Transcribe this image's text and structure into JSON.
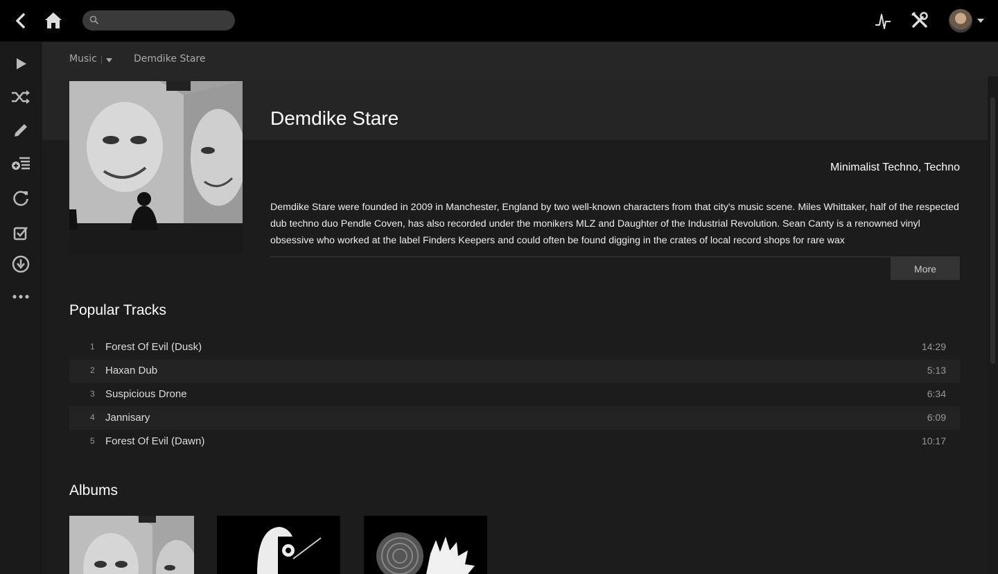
{
  "search": {
    "placeholder": ""
  },
  "breadcrumb": {
    "section": "Music",
    "current": "Demdike Stare"
  },
  "artist": {
    "name": "Demdike Stare",
    "genres": "Minimalist Techno, Techno",
    "bio": "Demdike Stare were founded in 2009 in Manchester, England by two well-known characters from that city's music scene. Miles Whittaker, half of the respected dub techno duo Pendle Coven, has also recorded under the monikers MLZ and Daughter of the Industrial Revolution. Sean Canty is a renowned vinyl obsessive who worked at the label Finders Keepers and could often be found digging in the crates of local record shops for rare wax",
    "more_label": "More"
  },
  "popular": {
    "title": "Popular Tracks",
    "tracks": [
      {
        "num": "1",
        "title": "Forest Of Evil (Dusk)",
        "duration": "14:29"
      },
      {
        "num": "2",
        "title": "Haxan Dub",
        "duration": "5:13"
      },
      {
        "num": "3",
        "title": "Suspicious Drone",
        "duration": "6:34"
      },
      {
        "num": "4",
        "title": "Jannisary",
        "duration": "6:09"
      },
      {
        "num": "5",
        "title": "Forest Of Evil (Dawn)",
        "duration": "10:17"
      }
    ]
  },
  "albums": {
    "title": "Albums"
  },
  "icons": {
    "back": "chevron-left-icon",
    "home": "home-icon",
    "search": "search-icon",
    "activity": "activity-icon",
    "settings": "tools-icon",
    "user": "avatar",
    "sidebar": [
      "play-icon",
      "shuffle-icon",
      "edit-icon",
      "playlist-add-icon",
      "refresh-icon",
      "checklist-icon",
      "download-icon",
      "more-icon"
    ]
  }
}
